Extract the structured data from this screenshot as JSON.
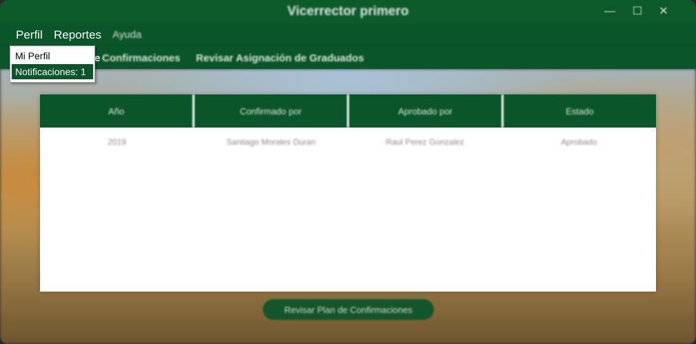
{
  "window": {
    "title": "Vicerrector primero",
    "minimize_label": "—",
    "maximize_label": "☐",
    "close_label": "✕"
  },
  "menubar": {
    "items": [
      {
        "label": "Perfil"
      },
      {
        "label": "Reportes"
      },
      {
        "label": "Ayuda"
      }
    ]
  },
  "dropdown": {
    "items": [
      {
        "label": "Mi Perfil"
      },
      {
        "label": "Notificaciones: 1"
      }
    ]
  },
  "subbar": {
    "partial_label": "e",
    "items": [
      {
        "label": "Confirmaciones"
      },
      {
        "label": "Revisar Asignación de Graduados"
      }
    ]
  },
  "table": {
    "columns": [
      "Año",
      "Confirmado por",
      "Aprobado por",
      "Estado"
    ],
    "rows": [
      [
        "2019",
        "Santiago Morales Duran",
        "Raul Perez Gonzalez",
        "Aprobado"
      ]
    ]
  },
  "bottom_button": {
    "label": "Revisar Plan de Confirmaciones"
  },
  "colors": {
    "primary": "#0b552a",
    "titlebar": "#0d5a2a",
    "active_menu": "#0b552a"
  }
}
